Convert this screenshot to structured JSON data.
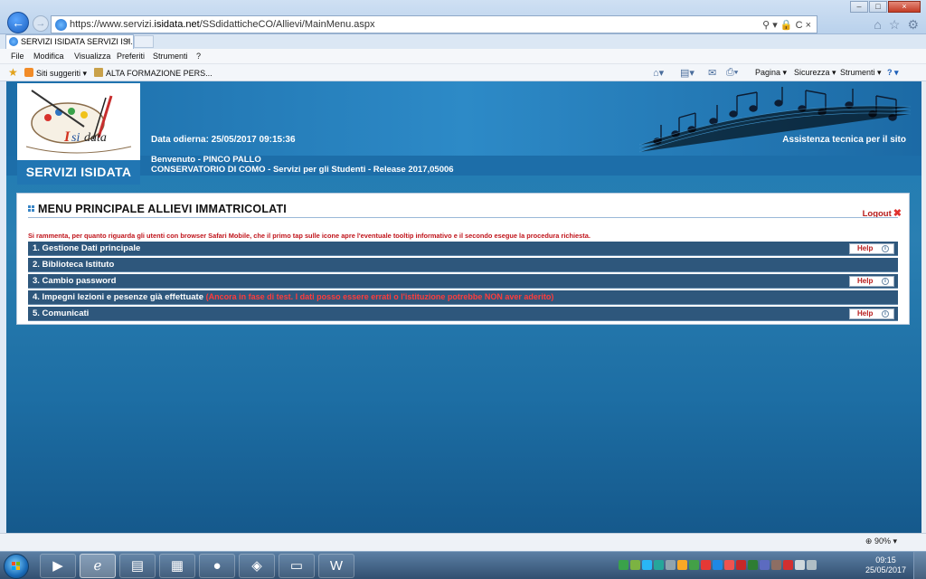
{
  "browser": {
    "url_prefix": "https://www.servizi.",
    "url_domain": "isidata.net",
    "url_path": "/SSdidatticheCO/Allievi/MainMenu.aspx",
    "address_tools": "⚲ ▾ 🔒 C ×",
    "tab_title": "SERVIZI ISIDATA SERVIZI ISI...",
    "tab_close": "×",
    "window_buttons": {
      "minimize": "–",
      "maximize": "□",
      "close": "×"
    },
    "menu": [
      "File",
      "Modifica",
      "Visualizza",
      "Preferiti",
      "Strumenti",
      "?"
    ],
    "favorites": [
      {
        "label": "Siti suggeriti ▾"
      },
      {
        "label": "ALTA FORMAZIONE PERS..."
      }
    ],
    "commands": {
      "pagina": "Pagina ▾",
      "sicurezza": "Sicurezza ▾",
      "strumenti": "Strumenti ▾",
      "help": "? ▾"
    },
    "zoom": "90%",
    "zoom_dropdown": "▾"
  },
  "header": {
    "logo_caption": "SERVIZI ISIDATA",
    "logo_text": "Isidata",
    "date_line": "Data odierna: 25/05/2017 09:15:36",
    "assistance_link": "Assistenza tecnica per il sito",
    "welcome_line": "Benvenuto - PINCO PALLO",
    "institution_line": "CONSERVATORIO DI COMO - Servizi per gli Studenti - Release 2017,05006"
  },
  "panel": {
    "title": "MENU PRINCIPALE ALLIEVI IMMATRICOLATI",
    "logout": "Logout",
    "notice": "Si rammenta, per quanto riguarda gli utenti con browser Safari Mobile, che il primo tap sulle icone apre l'eventuale tooltip informativo e il secondo esegue la procedura richiesta.",
    "items": [
      {
        "label": "1. Gestione Dati principale",
        "help": "Help",
        "warning": ""
      },
      {
        "label": "2. Biblioteca Istituto",
        "help": "",
        "warning": ""
      },
      {
        "label": "3. Cambio password",
        "help": "Help",
        "warning": ""
      },
      {
        "label": "4. Impegni lezioni e pesenze già effettuate",
        "help": "",
        "warning": "(Ancora in fase di test. I dati posso essere errati o l'istituzione potrebbe NON aver aderito)"
      },
      {
        "label": "5. Comunicati",
        "help": "Help",
        "warning": ""
      }
    ]
  },
  "taskbar": {
    "clock_time": "09:15",
    "clock_date": "25/05/2017"
  },
  "colors": {
    "page_blue": "#1b7ab4",
    "menu_row": "#2e577c",
    "alert_red": "#c0141b"
  }
}
